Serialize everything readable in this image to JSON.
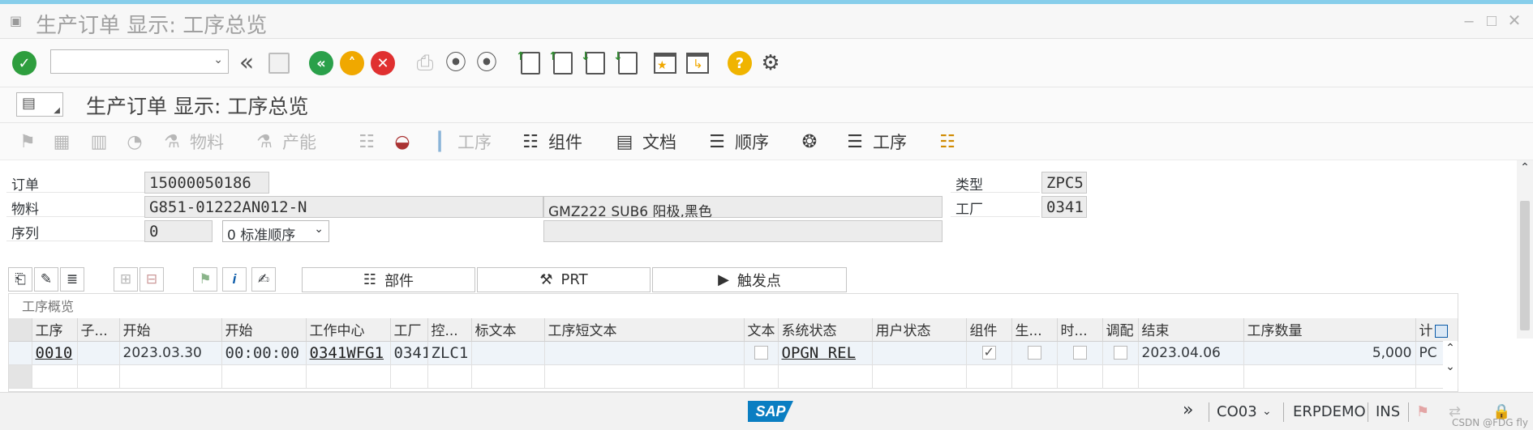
{
  "window": {
    "title": "生产订单 显示: 工序总览"
  },
  "toolbar": {
    "command_field_value": "",
    "icons": [
      "enter-icon",
      "back-double-icon",
      "save-icon",
      "back-icon",
      "exit-icon",
      "cancel-icon",
      "print-icon",
      "find-icon",
      "find-next-icon",
      "first-page-icon",
      "prev-page-icon",
      "next-page-icon",
      "last-page-icon",
      "new-session-icon",
      "shortcut-icon",
      "help-icon",
      "settings-icon"
    ]
  },
  "app": {
    "title": "生产订单 显示: 工序总览"
  },
  "app_toolbar": {
    "material_label": "物料",
    "capacity_label": "产能",
    "operation_label_1": "工序",
    "components_label": "组件",
    "documents_label": "文档",
    "sequence_label": "顺序",
    "operation_label_2": "工序"
  },
  "header": {
    "order_label": "订单",
    "order_value": "15000050186",
    "material_label": "物料",
    "material_value": "G851-01222AN012-N",
    "material_desc": "GMZ222 SUB6 阳极,黑色",
    "sequence_label": "序列",
    "sequence_value": "0",
    "sequence_select": "0 标准顺序",
    "type_label": "类型",
    "type_value": "ZPC5",
    "plant_label": "工厂",
    "plant_value": "0341",
    "extra_value": ""
  },
  "tabs": {
    "parts_label": "部件",
    "prt_label": "PRT",
    "trigger_label": "触发点"
  },
  "grid": {
    "title": "工序概览",
    "columns": [
      "工序",
      "子...",
      "开始",
      "开始",
      "工作中心",
      "工厂",
      "控...",
      "标文本",
      "工序短文本",
      "文本",
      "系统状态",
      "用户状态",
      "组件",
      "生...",
      "时...",
      "调配",
      "结束",
      "工序数量",
      "计"
    ],
    "row": {
      "operation": "0010",
      "sub": "",
      "start_date": "2023.03.30",
      "start_time": "00:00:00",
      "work_center": "0341WFG1",
      "plant": "0341",
      "control": "ZLC1",
      "std_text": "",
      "short_text": "",
      "system_status": "OPGN  REL",
      "user_status": "",
      "end_date": "2023.04.06",
      "quantity": "5,000",
      "unit": "PC"
    }
  },
  "status": {
    "tcode": "CO03",
    "system": "ERPDEMO",
    "mode": "INS",
    "watermark": "CSDN @FDG fly"
  },
  "colors": {
    "enter_green": "#2e9e3e",
    "nav_green": "#2aa04a",
    "nav_orange": "#f0a800",
    "cancel_red": "#e03030",
    "help_yellow": "#f0b400",
    "sap_blue": "#0a7ec2",
    "top_strip": "#87ceeb"
  }
}
